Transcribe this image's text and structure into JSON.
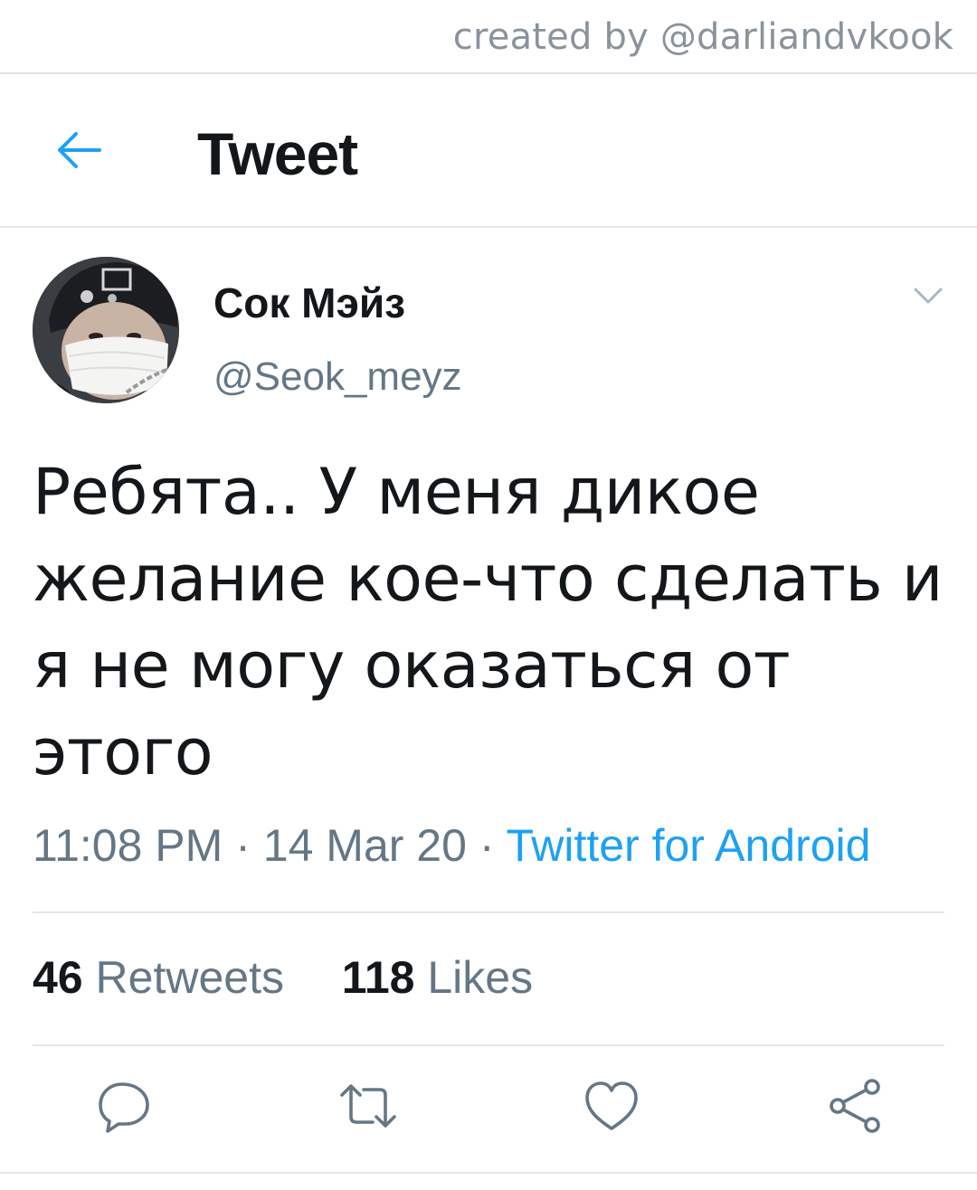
{
  "watermark": "created by @darliandvkook",
  "header": {
    "title": "Tweet",
    "back_icon": "arrow-left-icon"
  },
  "tweet": {
    "display_name": "Сок Мэйз",
    "handle": "@Seok_meyz",
    "text": "Ребята.. У меня дикое желание кое-что сделать и я не могу оказаться от этого",
    "time": "11:08 PM",
    "date": "14 Mar 20",
    "separator": "·",
    "source": "Twitter for Android",
    "retweets_count": "46",
    "retweets_label": "Retweets",
    "likes_count": "118",
    "likes_label": "Likes"
  },
  "actions": [
    "reply-icon",
    "retweet-icon",
    "like-icon",
    "share-icon"
  ],
  "colors": {
    "accent": "#1da1f2",
    "text_primary": "#14171a",
    "text_secondary": "#657786",
    "divider": "#e1e6ea"
  }
}
